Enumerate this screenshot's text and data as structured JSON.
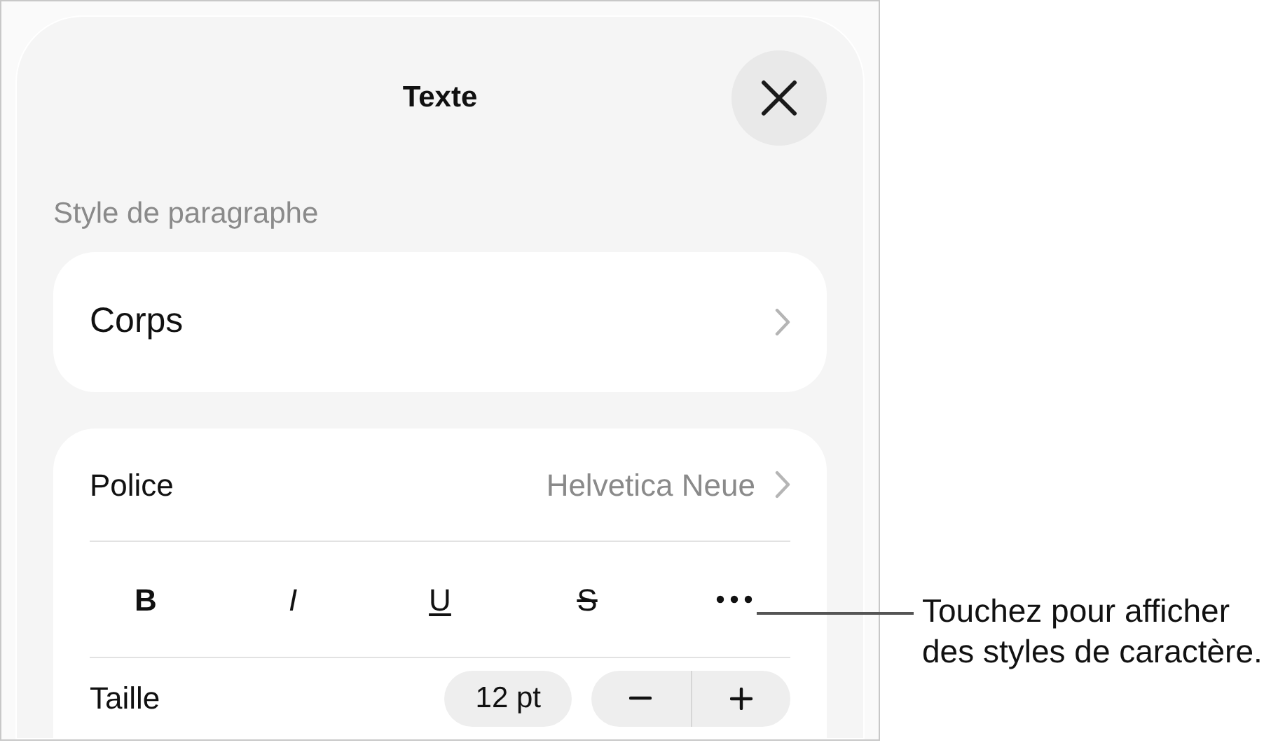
{
  "panel": {
    "title": "Texte"
  },
  "paragraph_style": {
    "label": "Style de paragraphe",
    "value": "Corps"
  },
  "font": {
    "label": "Police",
    "value": "Helvetica Neue"
  },
  "format_buttons": [
    {
      "kind": "bold",
      "label": "B"
    },
    {
      "kind": "italic",
      "label": "I"
    },
    {
      "kind": "underline",
      "label": "U"
    },
    {
      "kind": "strikethrough",
      "label": "S"
    },
    {
      "kind": "more"
    }
  ],
  "size": {
    "label": "Taille",
    "value": "12 pt"
  },
  "callout": "Touchez pour afficher des styles de caractère."
}
